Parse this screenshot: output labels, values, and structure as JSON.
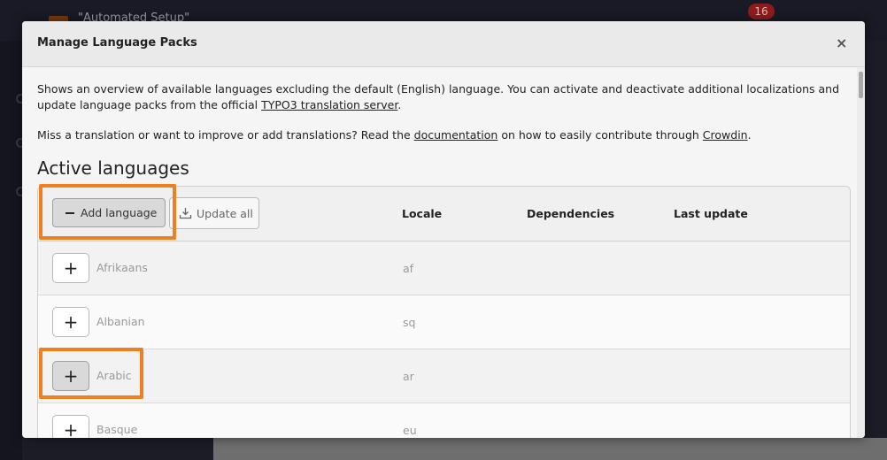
{
  "background": {
    "window_title": "\"Automated Setup\"",
    "notification_count": "16"
  },
  "modal": {
    "title": "Manage Language Packs",
    "close_label": "×",
    "intro": {
      "text_before": "Shows an overview of available languages excluding the default (English) language. You can activate and deactivate additional localizations and update language packs from the official ",
      "link": "TYPO3 translation server",
      "text_after": "."
    },
    "help": {
      "text_before": "Miss a translation or want to improve or add translations? Read the ",
      "link1": "documentation",
      "text_middle": " on how to easily contribute through ",
      "link2": "Crowdin",
      "text_after": "."
    },
    "section_title": "Active languages",
    "buttons": {
      "add_language": "Add language",
      "update_all": "Update all"
    },
    "columns": {
      "locale": "Locale",
      "dependencies": "Dependencies",
      "last_update": "Last update"
    },
    "languages": [
      {
        "name": "Afrikaans",
        "locale": "af"
      },
      {
        "name": "Albanian",
        "locale": "sq"
      },
      {
        "name": "Arabic",
        "locale": "ar"
      },
      {
        "name": "Basque",
        "locale": "eu"
      }
    ],
    "row_action_label": "+"
  },
  "colors": {
    "highlight": "#f07f1f",
    "modal_background": "#f5f5f5",
    "backdrop": "#1c1c27"
  },
  "icons": {
    "minus": "minus-icon",
    "download": "download-icon",
    "plus": "plus-icon"
  }
}
